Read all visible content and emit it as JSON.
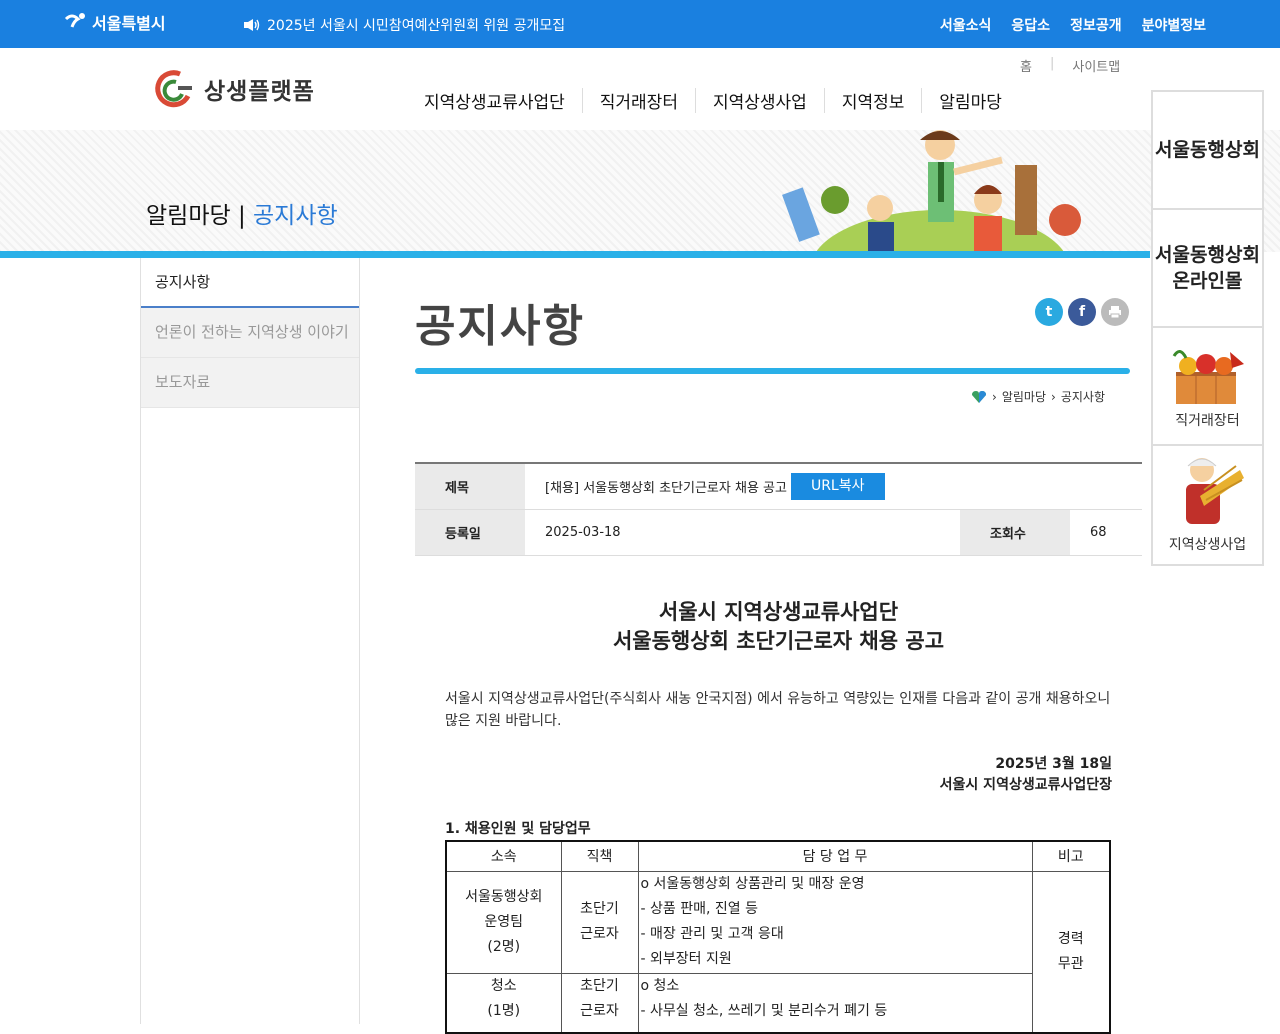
{
  "topbar": {
    "logo": "서울특별시",
    "notice": "2025년 서울시 시민참여예산위원회 위원 공개모집",
    "links": [
      "서울소식",
      "응답소",
      "정보공개",
      "분야별정보"
    ]
  },
  "header": {
    "brand": "상생플랫폼",
    "util": [
      "홈",
      "사이트맵"
    ],
    "gnb": [
      "지역상생교류사업단",
      "직거래장터",
      "지역상생사업",
      "지역정보",
      "알림마당"
    ]
  },
  "banner": {
    "section": "알림마당",
    "current": "공지사항"
  },
  "lnb": [
    "공지사항",
    "언론이 전하는 지역상생 이야기",
    "보도자료"
  ],
  "page": {
    "title": "공지사항",
    "breadcrumb": [
      "알림마당",
      "공지사항"
    ]
  },
  "post": {
    "subject_label": "제목",
    "subject": "[채용] 서울동행상회 초단기근로자 채용 공고",
    "url_button": "URL복사",
    "date_label": "등록일",
    "date": "2025-03-18",
    "views_label": "조회수",
    "views": "68"
  },
  "doc": {
    "title_line1": "서울시 지역상생교류사업단",
    "title_line2": "서울동행상회 초단기근로자 채용 공고",
    "intro": "서울시 지역상생교류사업단(주식회사 새농 안국지점) 에서 유능하고 역량있는 인재를 다음과 같이 공개 채용하오니 많은 지원 바랍니다.",
    "date": "2025년 3월 18일",
    "org": "서울시 지역상생교류사업단장",
    "section1": "1. 채용인원 및 담당업무",
    "table": {
      "headers": [
        "소속",
        "직책",
        "담 당 업 무",
        "비고"
      ],
      "row1": {
        "dept": [
          "서울동행상회",
          "운영팀",
          "(2명)"
        ],
        "pos": [
          "초단기",
          "근로자"
        ],
        "duties": [
          "o 서울동행상회 상품관리 및 매장 운영",
          "- 상품 판매, 진열 등",
          "- 매장 관리 및 고객 응대",
          "- 외부장터 지원"
        ]
      },
      "note": [
        "경력",
        "무관"
      ],
      "row2": {
        "dept": [
          "청소",
          "(1명)"
        ],
        "pos": [
          "초단기",
          "근로자"
        ],
        "duties": [
          "o 청소",
          "- 사무실 청소, 쓰레기 및 분리수거 폐기 등"
        ]
      }
    }
  },
  "quick": {
    "q1": "서울동행상회",
    "q2_line1": "서울동행상회",
    "q2_line2": "온라인몰",
    "q3": "직거래장터",
    "q4": "지역상생사업"
  },
  "colors": {
    "topbar": "#1a80e0",
    "accent_line": "#2ab0e8",
    "highlight": "#2a7ad6"
  }
}
